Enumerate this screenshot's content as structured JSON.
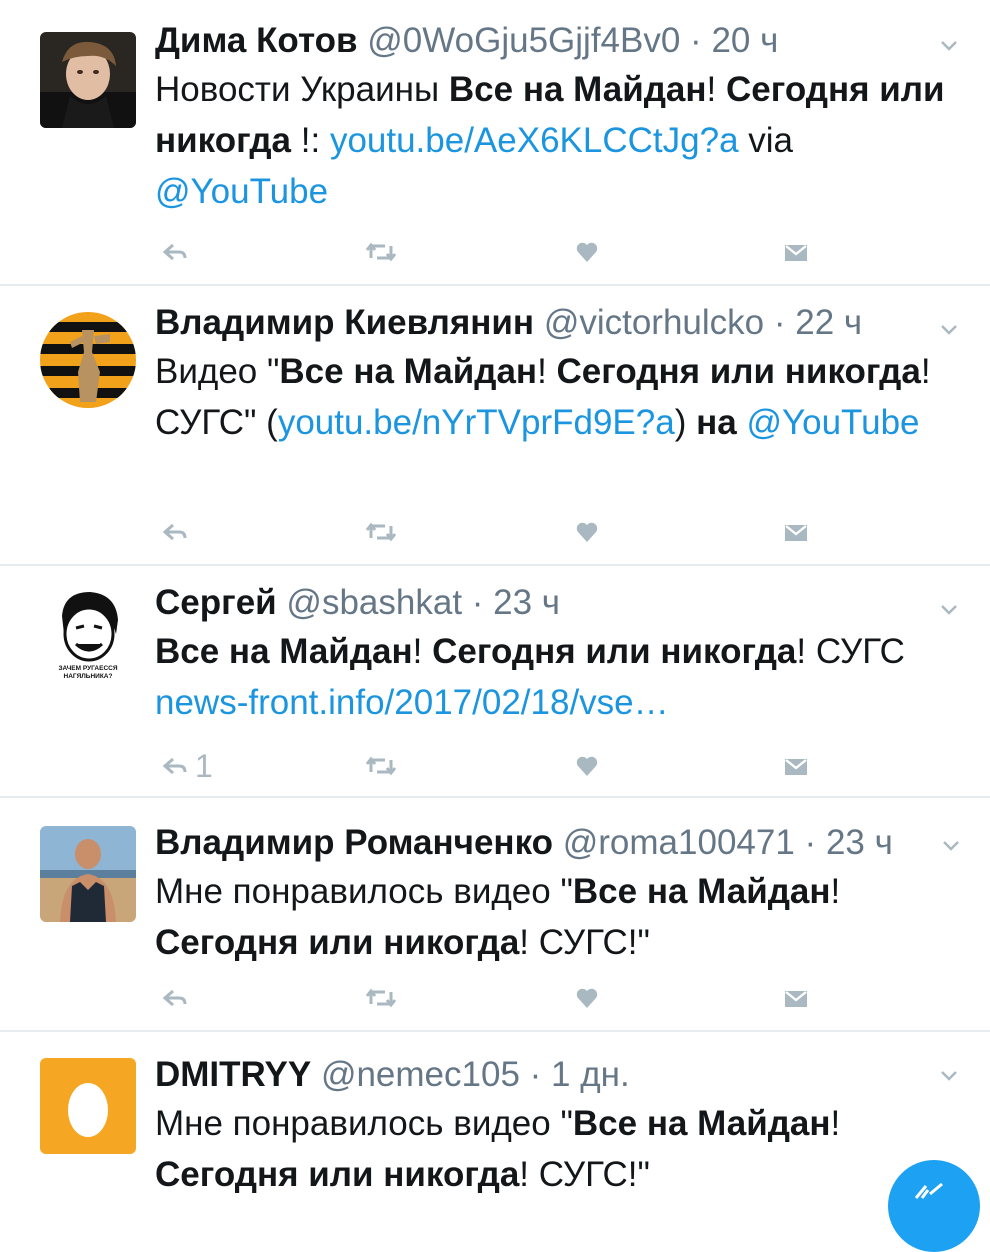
{
  "tweets": [
    {
      "name": "Дима Котов",
      "handle": "@0WoGju5Gjjf4Bv0",
      "time": "20 ч",
      "text": [
        {
          "t": "Новости Украины "
        },
        {
          "t": "Все на Майдан",
          "b": true
        },
        {
          "t": "! "
        },
        {
          "t": "Сегодня или никогда",
          "b": true
        },
        {
          "t": " !: "
        },
        {
          "t": "youtu.be/AeX6KLCCtJg?a",
          "link": true
        },
        {
          "t": " via "
        },
        {
          "t": "@YouTube",
          "link": true
        }
      ],
      "replies": ""
    },
    {
      "name": "Владимир Киевлянин",
      "handle": "@victorhulcko",
      "time": "22 ч",
      "text": [
        {
          "t": "Видео \""
        },
        {
          "t": "Все на Майдан",
          "b": true
        },
        {
          "t": "! "
        },
        {
          "t": "Сегодня или никогда",
          "b": true
        },
        {
          "t": "! СУГС\" ("
        },
        {
          "t": "youtu.be/nYrTVprFd9E?a",
          "link": true
        },
        {
          "t": ") "
        },
        {
          "t": "на",
          "b": true
        },
        {
          "t": " "
        },
        {
          "t": "@YouTube",
          "link": true
        }
      ],
      "replies": ""
    },
    {
      "name": "Сергей",
      "handle": "@sbashkat",
      "time": "23 ч",
      "text": [
        {
          "t": "Все на Майдан",
          "b": true
        },
        {
          "t": "! "
        },
        {
          "t": "Сегодня или никогда",
          "b": true
        },
        {
          "t": "! СУГС "
        },
        {
          "t": "news-front.info/2017/02/18/vse…",
          "link": true
        }
      ],
      "replies": "1",
      "avatar_caption": "ЗАЧЕМ РУГАЕССЯ НАГЯЛЬНИКА?"
    },
    {
      "name": "Владимир Романченко",
      "handle": "@roma100471",
      "time": "23 ч",
      "text": [
        {
          "t": "Мне понравилось видео \""
        },
        {
          "t": "Все на Майдан",
          "b": true
        },
        {
          "t": "! "
        },
        {
          "t": "Сегодня или никогда",
          "b": true
        },
        {
          "t": "! СУГС!\""
        }
      ],
      "replies": ""
    },
    {
      "name": "DMITRYY",
      "handle": "@nemec105",
      "time": "1 дн.",
      "text": [
        {
          "t": "Мне понравилось видео \""
        },
        {
          "t": "Все на Майдан",
          "b": true
        },
        {
          "t": "! "
        },
        {
          "t": "Сегодня или никогда",
          "b": true
        },
        {
          "t": "! СУГС!\""
        }
      ],
      "replies": ""
    }
  ],
  "colors": {
    "link": "#1b95e0",
    "muted": "#657786",
    "icon": "#aab8c2",
    "divider": "#e6ecf0",
    "fab": "#1da1f2",
    "egg_bg": "#f5a623"
  },
  "icons": [
    "reply-icon",
    "retweet-icon",
    "like-icon",
    "direct-message-icon",
    "chevron-down-icon",
    "compose-tweet-icon"
  ]
}
